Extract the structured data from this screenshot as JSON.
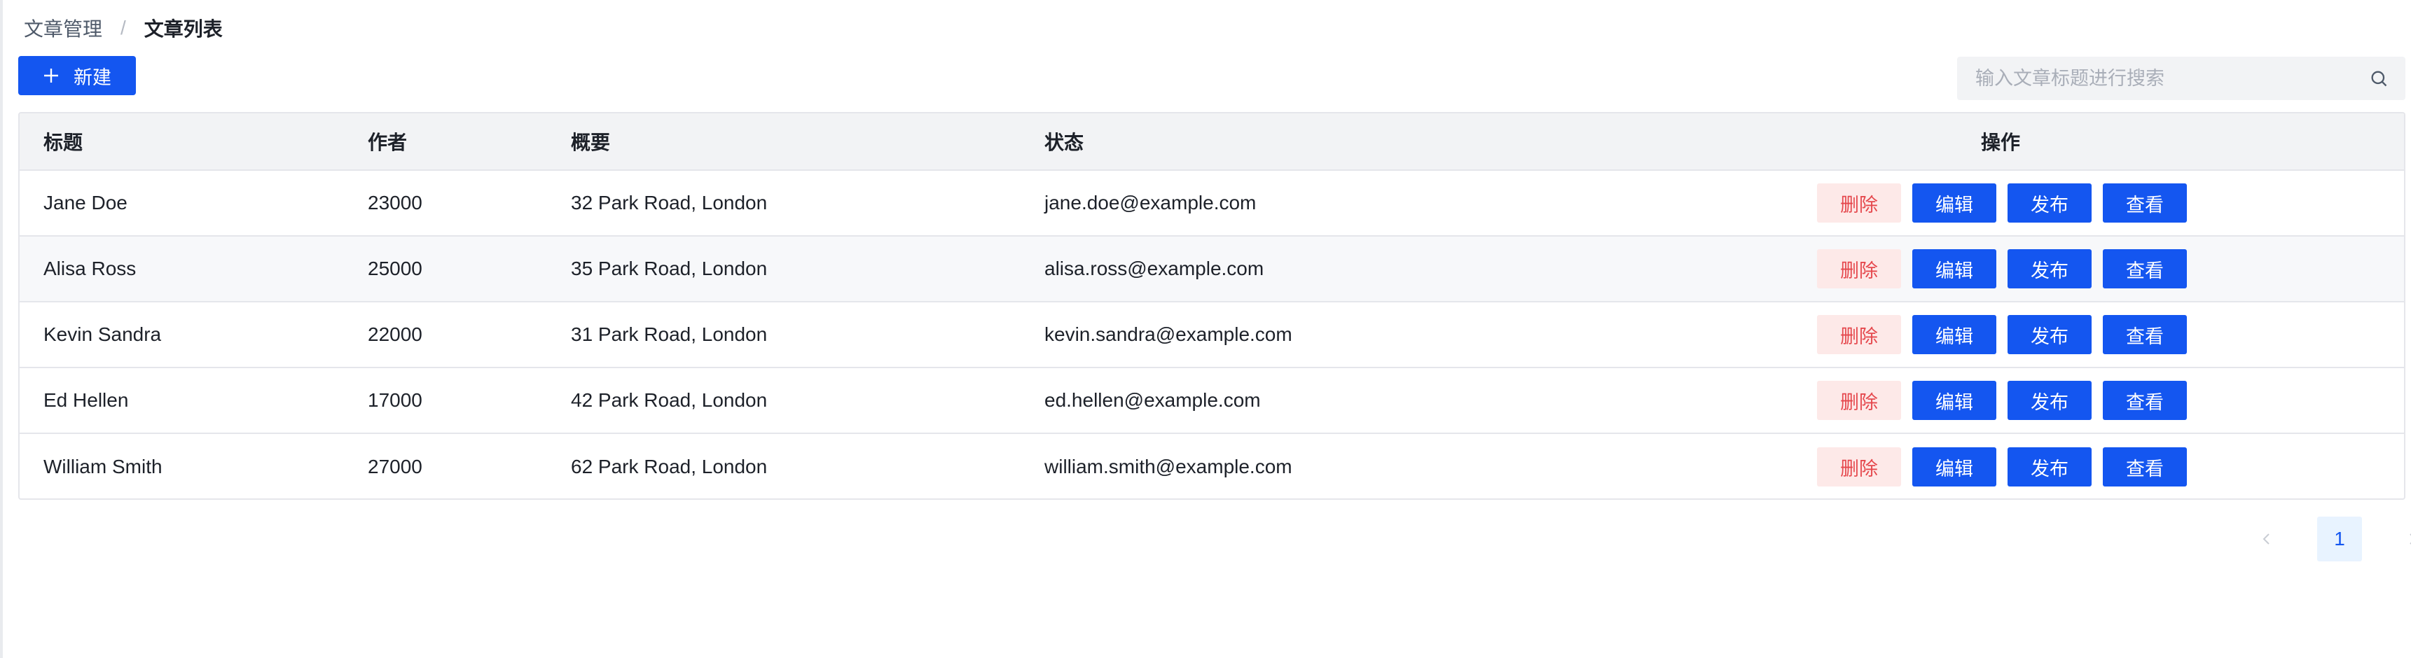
{
  "breadcrumb": {
    "parent": "文章管理",
    "separator": "/",
    "current": "文章列表"
  },
  "toolbar": {
    "new_label": "新建",
    "new_icon": "plus-icon"
  },
  "search": {
    "placeholder": "输入文章标题进行搜索",
    "value": "",
    "icon": "search-icon"
  },
  "table": {
    "columns": {
      "title": "标题",
      "author": "作者",
      "summary": "概要",
      "status": "状态",
      "ops": "操作"
    },
    "actions": {
      "delete": "删除",
      "edit": "编辑",
      "publish": "发布",
      "view": "查看"
    },
    "rows": [
      {
        "title": "Jane Doe",
        "author": "23000",
        "summary": "32 Park Road, London",
        "status": "jane.doe@example.com"
      },
      {
        "title": "Alisa Ross",
        "author": "25000",
        "summary": "35 Park Road, London",
        "status": "alisa.ross@example.com"
      },
      {
        "title": "Kevin Sandra",
        "author": "22000",
        "summary": "31 Park Road, London",
        "status": "kevin.sandra@example.com"
      },
      {
        "title": "Ed Hellen",
        "author": "17000",
        "summary": "42 Park Road, London",
        "status": "ed.hellen@example.com"
      },
      {
        "title": "William Smith",
        "author": "27000",
        "summary": "62 Park Road, London",
        "status": "william.smith@example.com"
      }
    ]
  },
  "pagination": {
    "current": "1",
    "prev_icon": "chevron-left-icon",
    "next_icon": "chevron-right-icon"
  },
  "colors": {
    "primary": "#1456f0",
    "danger_bg": "#fde9e8",
    "danger_text": "#e5484d",
    "header_bg": "#f2f3f5"
  }
}
